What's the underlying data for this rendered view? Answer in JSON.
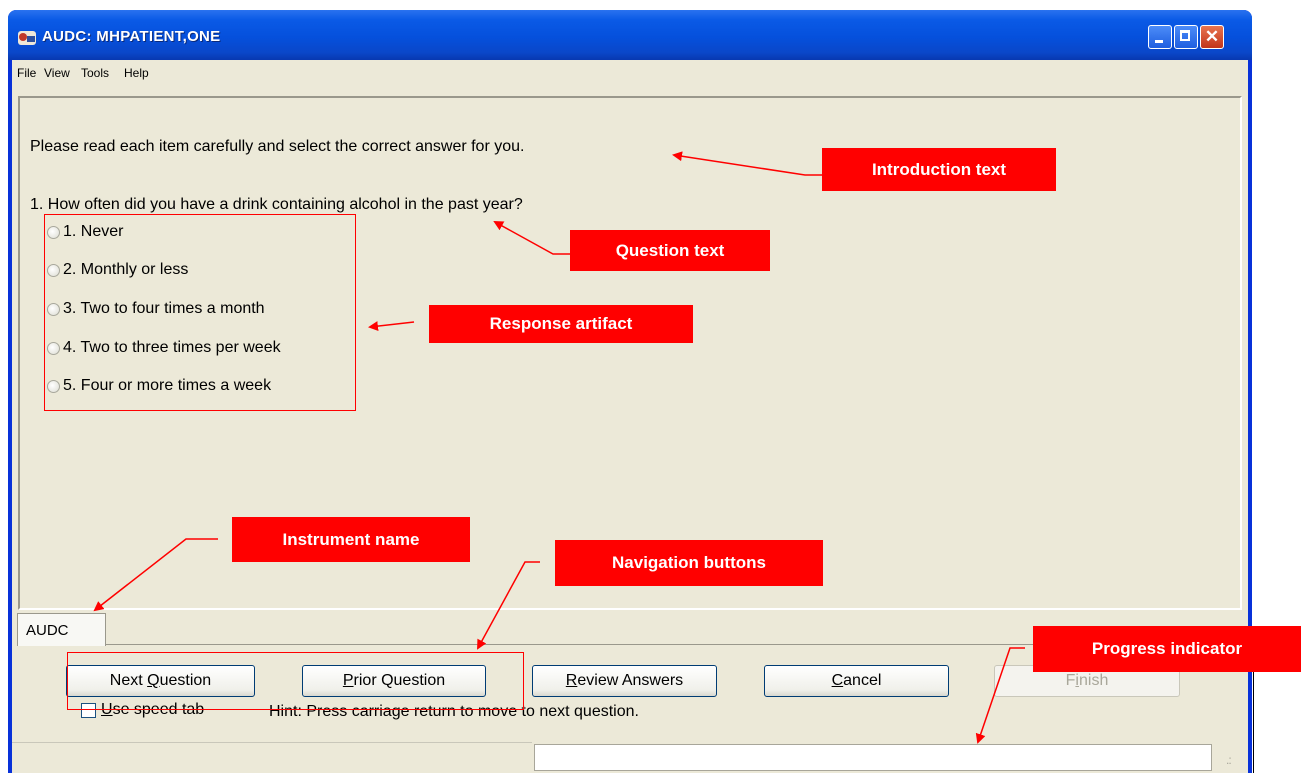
{
  "window": {
    "title": "AUDC: MHPATIENT,ONE",
    "min_glyph": "",
    "max_glyph": "",
    "close_glyph": "✕"
  },
  "menu": {
    "items": [
      "File",
      "View",
      "Tools",
      "Help"
    ]
  },
  "content": {
    "intro": "Please read each item carefully and select the correct answer for you.",
    "question": "1. How often did you have a drink containing alcohol in the past year?",
    "options": [
      "1. Never",
      "2. Monthly or less",
      "3. Two to four times a month",
      "4. Two to three times per week",
      "5. Four or more times a week"
    ],
    "selected_option": null
  },
  "tab": {
    "label": "AUDC"
  },
  "buttons": {
    "next": {
      "underline": "Q",
      "before": "Next ",
      "after": "uestion"
    },
    "prior": {
      "underline": "P",
      "before": "",
      "after": "rior Question"
    },
    "review": {
      "underline": "R",
      "before": "",
      "after": "eview Answers"
    },
    "cancel": {
      "underline": "C",
      "before": "",
      "after": "ancel"
    },
    "finish": {
      "underline": "i",
      "before": "F",
      "after": "nish"
    }
  },
  "speed_tab": {
    "underline": "U",
    "rest": "se speed tab",
    "checked": false
  },
  "hint": "Hint: Press carriage return to move to next question.",
  "annotations": {
    "intro": "Introduction text",
    "question": "Question text",
    "response": "Response artifact",
    "instrument": "Instrument name",
    "navigation": "Navigation buttons",
    "progress": "Progress indicator"
  },
  "colors": {
    "annotation": "#ff0000",
    "titlebar": "#0a5ae6",
    "client": "#ece9d8"
  }
}
